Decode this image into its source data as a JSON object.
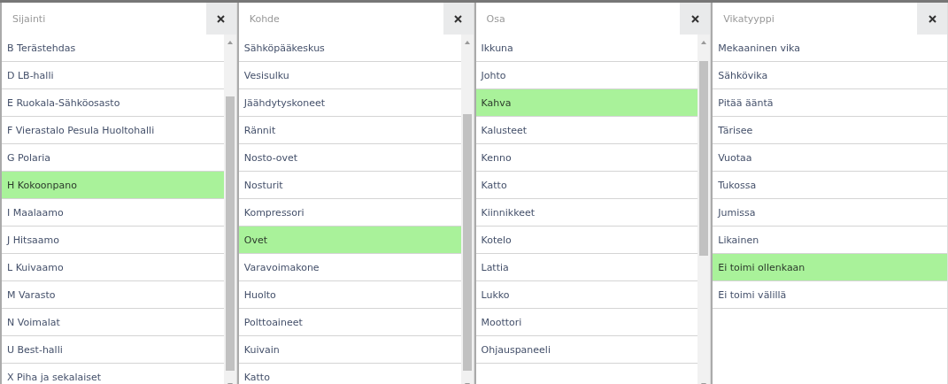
{
  "columns": [
    {
      "placeholder": "Sijainti",
      "items": [
        {
          "label": "B Terästehdas",
          "selected": false
        },
        {
          "label": "D LB-halli",
          "selected": false
        },
        {
          "label": "E Ruokala-Sähköosasto",
          "selected": false
        },
        {
          "label": "F Vierastalo Pesula Huoltohalli",
          "selected": false
        },
        {
          "label": "G Polaria",
          "selected": false
        },
        {
          "label": "H Kokoonpano",
          "selected": true
        },
        {
          "label": "I Maalaamo",
          "selected": false
        },
        {
          "label": "J Hitsaamo",
          "selected": false
        },
        {
          "label": "L Kuivaamo",
          "selected": false
        },
        {
          "label": "M Varasto",
          "selected": false
        },
        {
          "label": "N Voimalat",
          "selected": false
        },
        {
          "label": "U Best-halli",
          "selected": false
        },
        {
          "label": "X Piha ja sekalaiset",
          "selected": false
        }
      ]
    },
    {
      "placeholder": "Kohde",
      "items": [
        {
          "label": "Sähköpääkeskus",
          "selected": false
        },
        {
          "label": "Vesisulku",
          "selected": false
        },
        {
          "label": "Jäähdytyskoneet",
          "selected": false
        },
        {
          "label": "Rännit",
          "selected": false
        },
        {
          "label": "Nosto-ovet",
          "selected": false
        },
        {
          "label": "Nosturit",
          "selected": false
        },
        {
          "label": "Kompressori",
          "selected": false
        },
        {
          "label": "Ovet",
          "selected": true
        },
        {
          "label": "Varavoimakone",
          "selected": false
        },
        {
          "label": "Huolto",
          "selected": false
        },
        {
          "label": "Polttoaineet",
          "selected": false
        },
        {
          "label": "Kuivain",
          "selected": false
        },
        {
          "label": "Katto",
          "selected": false
        }
      ]
    },
    {
      "placeholder": "Osa",
      "items": [
        {
          "label": "Ikkuna",
          "selected": false
        },
        {
          "label": "Johto",
          "selected": false
        },
        {
          "label": "Kahva",
          "selected": true
        },
        {
          "label": "Kalusteet",
          "selected": false
        },
        {
          "label": "Kenno",
          "selected": false
        },
        {
          "label": "Katto",
          "selected": false
        },
        {
          "label": "Kiinnikkeet",
          "selected": false
        },
        {
          "label": "Kotelo",
          "selected": false
        },
        {
          "label": "Lattia",
          "selected": false
        },
        {
          "label": "Lukko",
          "selected": false
        },
        {
          "label": "Moottori",
          "selected": false
        },
        {
          "label": "Ohjauspaneeli",
          "selected": false
        }
      ]
    },
    {
      "placeholder": "Vikatyyppi",
      "items": [
        {
          "label": "Mekaaninen vika",
          "selected": false
        },
        {
          "label": "Sähkövika",
          "selected": false
        },
        {
          "label": "Pitää ääntä",
          "selected": false
        },
        {
          "label": "Tärisee",
          "selected": false
        },
        {
          "label": "Vuotaa",
          "selected": false
        },
        {
          "label": "Tukossa",
          "selected": false
        },
        {
          "label": "Jumissa",
          "selected": false
        },
        {
          "label": "Likainen",
          "selected": false
        },
        {
          "label": "Ei toimi ollenkaan",
          "selected": true
        },
        {
          "label": "Ei toimi välillä",
          "selected": false
        }
      ]
    }
  ]
}
